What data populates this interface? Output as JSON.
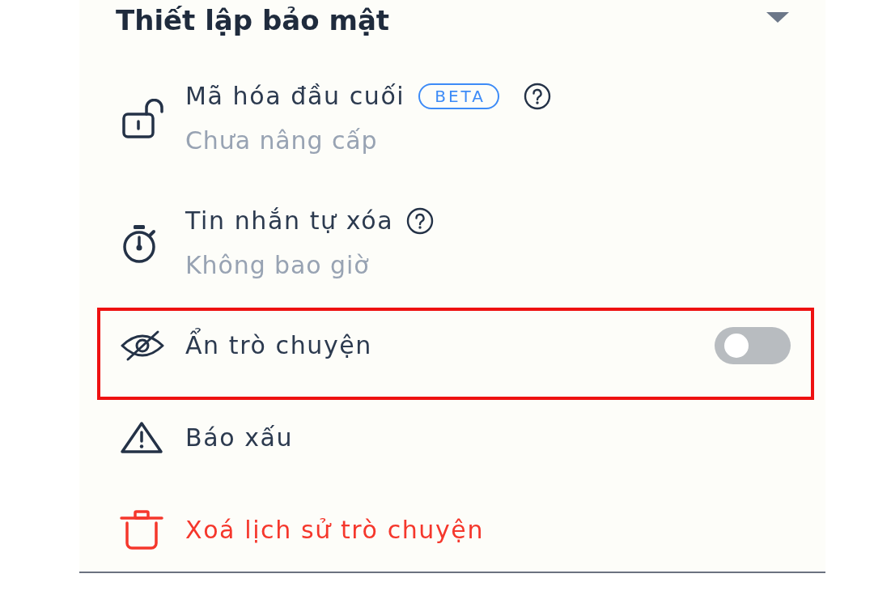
{
  "settings_section": {
    "title": "Thiết lập bảo mật",
    "expanded": true,
    "items": [
      {
        "kind": "encryption",
        "title": "Mã hóa đầu cuối",
        "badge": "BETA",
        "help": true,
        "subtitle": "Chưa nâng cấp",
        "highlighted": false
      },
      {
        "kind": "timer",
        "title": "Tin nhắn tự xóa",
        "help": true,
        "subtitle": "Không bao giờ",
        "highlighted": false
      },
      {
        "kind": "hide",
        "title": "Ẩn trò chuyện",
        "help": false,
        "toggle": {
          "on": false
        },
        "highlighted": true
      },
      {
        "kind": "report",
        "title": "Báo xấu",
        "help": false,
        "highlighted": false
      },
      {
        "kind": "delete",
        "title": "Xoá lịch sử trò chuyện",
        "help": false,
        "highlighted": false
      }
    ]
  }
}
